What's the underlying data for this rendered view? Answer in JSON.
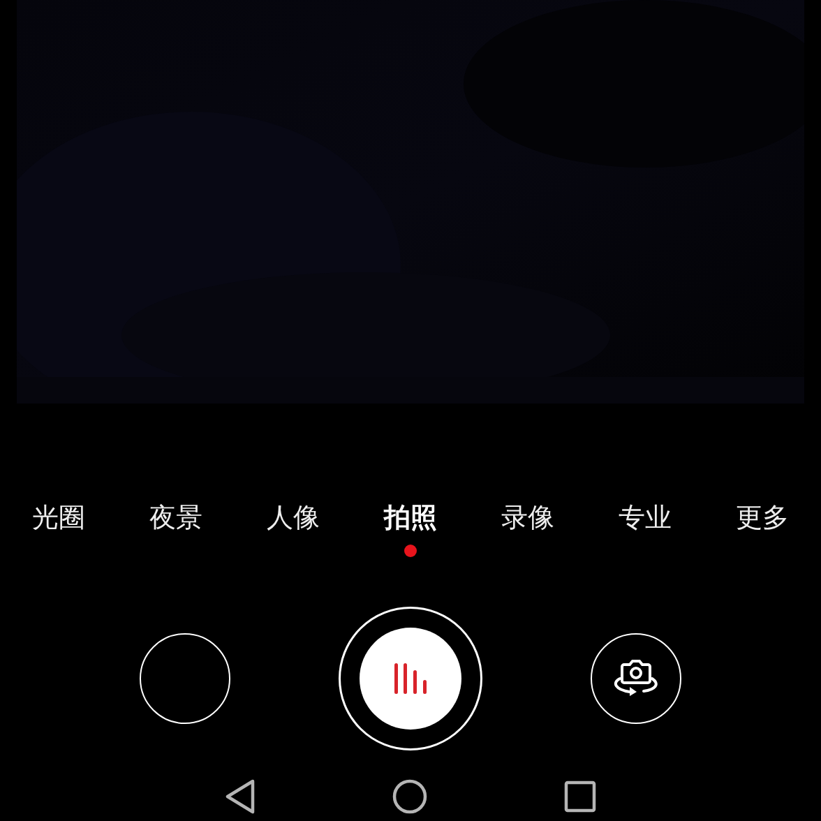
{
  "modes": [
    {
      "label": "光圈",
      "selected": false
    },
    {
      "label": "夜景",
      "selected": false
    },
    {
      "label": "人像",
      "selected": false
    },
    {
      "label": "拍照",
      "selected": true
    },
    {
      "label": "录像",
      "selected": false
    },
    {
      "label": "专业",
      "selected": false
    },
    {
      "label": "更多",
      "selected": false
    }
  ]
}
